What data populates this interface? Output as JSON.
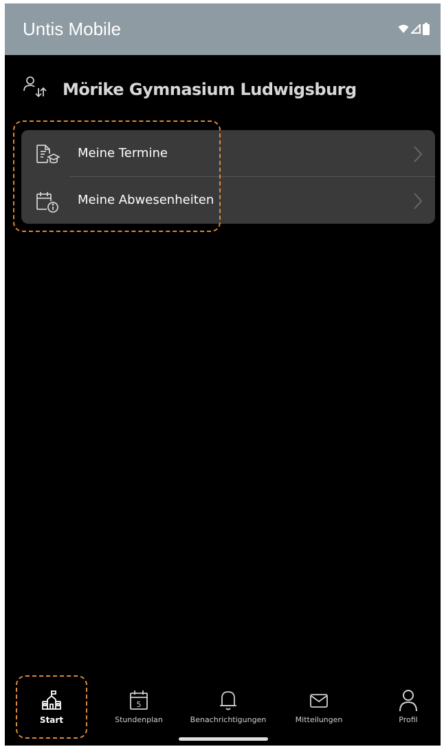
{
  "app": {
    "title": "Untis Mobile"
  },
  "status_bar": {
    "icons": [
      "wifi-icon",
      "signal-icon",
      "battery-icon"
    ]
  },
  "school": {
    "name": "Mörike Gymnasium Ludwigsburg",
    "icon": "switch-user-icon"
  },
  "menu": {
    "items": [
      {
        "label": "Meine Termine",
        "icon": "document-graduation-icon"
      },
      {
        "label": "Meine Abwesenheiten",
        "icon": "calendar-info-icon"
      }
    ]
  },
  "bottom_nav": {
    "items": [
      {
        "label": "Start",
        "icon": "school-building-icon",
        "active": true
      },
      {
        "label": "Stundenplan",
        "icon": "calendar-day-icon",
        "day": "5"
      },
      {
        "label": "Benachrichtigungen",
        "icon": "bell-icon"
      },
      {
        "label": "Mitteilungen",
        "icon": "envelope-icon"
      },
      {
        "label": "Profil",
        "icon": "person-icon"
      }
    ]
  },
  "colors": {
    "app_bar": "#8e9ba3",
    "background": "#000000",
    "card": "#3a3a3a",
    "highlight": "#e0893a"
  }
}
